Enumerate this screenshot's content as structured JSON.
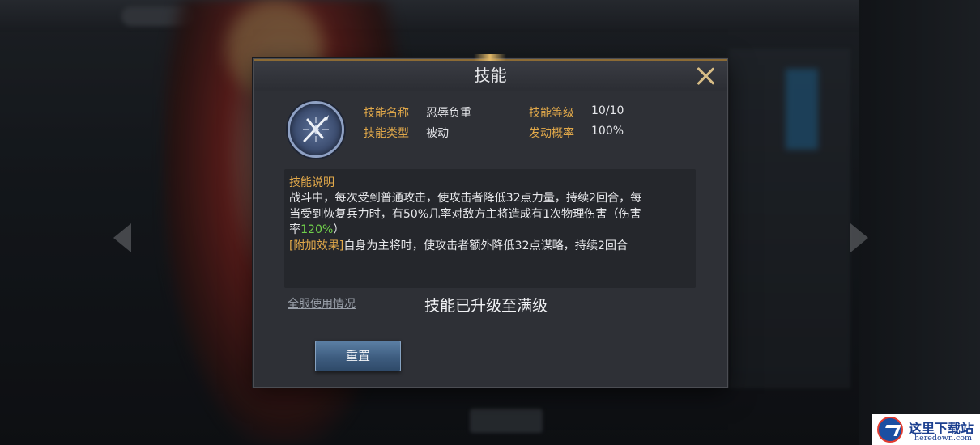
{
  "dialog": {
    "title": "技能",
    "close_icon": "close-icon"
  },
  "skill": {
    "icon": "crossed-swords-icon",
    "name_label": "技能名称",
    "name_value": "忍辱负重",
    "level_label": "技能等级",
    "level_value": "10/10",
    "type_label": "技能类型",
    "type_value": "被动",
    "trigger_label": "发动概率",
    "trigger_value": "100%"
  },
  "description": {
    "heading": "技能说明",
    "line1": "战斗中，每次受到普通攻击，使攻击者降低32点力量，持续2回合，每",
    "line2": "当受到恢复兵力时，有50%几率对敌方主将造成有1次物理伤害（伤害",
    "line3_prefix": "率",
    "line3_value": "120%",
    "line3_suffix": "）",
    "extra_tag": "[附加效果]",
    "extra_text": "自身为主将时，使攻击者额外降低32点谋略，持续2回合"
  },
  "usage_link": "全服使用情况",
  "status_text": "技能已升级至满级",
  "reset_button": "重置",
  "watermark": {
    "title": "这里下载站",
    "url": "heredown.com"
  },
  "colors": {
    "label_gold": "#e2a94a",
    "highlight_green": "#6fcf4a",
    "button_blue": "#3e5d80"
  }
}
